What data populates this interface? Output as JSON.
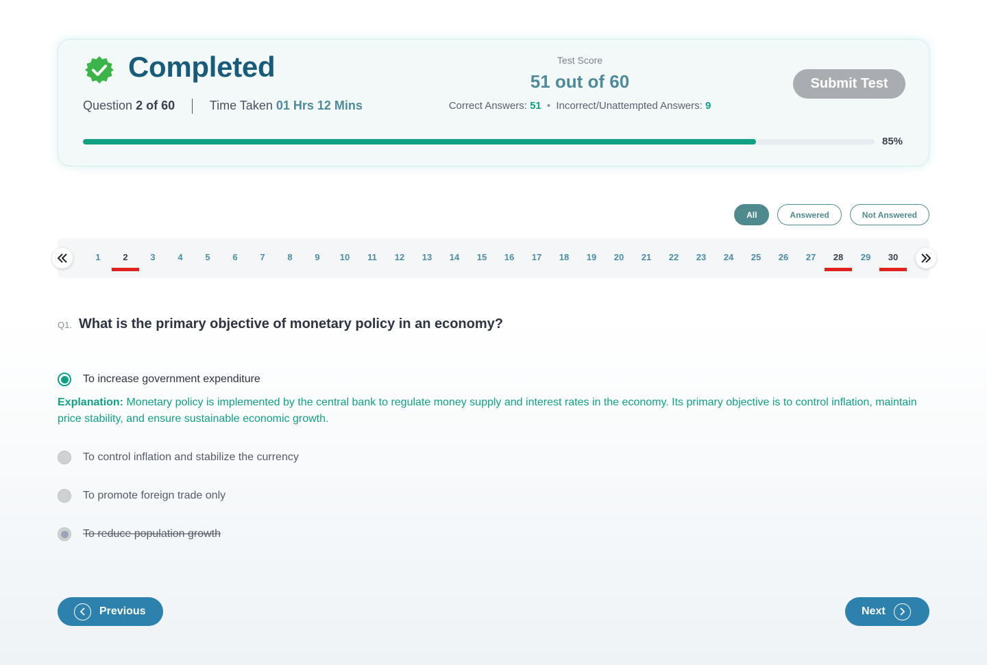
{
  "status": {
    "title": "Completed",
    "question_prefix": "Question",
    "question_position": "2 of 60",
    "time_prefix": "Time Taken",
    "time_value": "01 Hrs 12 Mins"
  },
  "score": {
    "label": "Test Score",
    "value": "51 out of 60",
    "correct_label": "Correct Answers:",
    "correct_value": "51",
    "incorrect_label": "Incorrect/Unattempted Answers:",
    "incorrect_value": "9"
  },
  "submit_label": "Submit Test",
  "progress": {
    "percent": 85,
    "label": "85%"
  },
  "filters": [
    "All",
    "Answered",
    "Not Answered"
  ],
  "question_nav": {
    "numbers": [
      "1",
      "2",
      "3",
      "4",
      "5",
      "6",
      "7",
      "8",
      "9",
      "10",
      "11",
      "12",
      "13",
      "14",
      "15",
      "16",
      "17",
      "18",
      "19",
      "20",
      "21",
      "22",
      "23",
      "24",
      "25",
      "26",
      "27",
      "28",
      "29",
      "30"
    ],
    "current": "2",
    "flagged": [
      "2",
      "28",
      "30"
    ]
  },
  "question": {
    "number": "Q1.",
    "text": "What is the primary objective of monetary policy in an economy?"
  },
  "options": [
    {
      "text": "To increase government expenditure",
      "state": "selected"
    },
    {
      "text": "To control inflation and stabilize the currency",
      "state": "unselected"
    },
    {
      "text": "To promote foreign trade only",
      "state": "unselected"
    },
    {
      "text": "To reduce population growth",
      "state": "struck"
    }
  ],
  "explanation": {
    "label": "Explanation:",
    "text": "Monetary policy is implemented by the central bank to regulate money supply and interest rates in the economy. Its primary objective is to control inflation, maintain price stability, and ensure sustainable economic growth."
  },
  "nav": {
    "previous": "Previous",
    "next": "Next"
  },
  "colors": {
    "accent_green": "#12a085",
    "title_blue": "#185b7a",
    "button_blue": "#2c82ad",
    "flag_red": "#e0221e"
  },
  "icons": [
    "verified-badge-icon",
    "double-chevron-left-icon",
    "double-chevron-right-icon",
    "chevron-left-circle-icon",
    "chevron-right-circle-icon"
  ]
}
